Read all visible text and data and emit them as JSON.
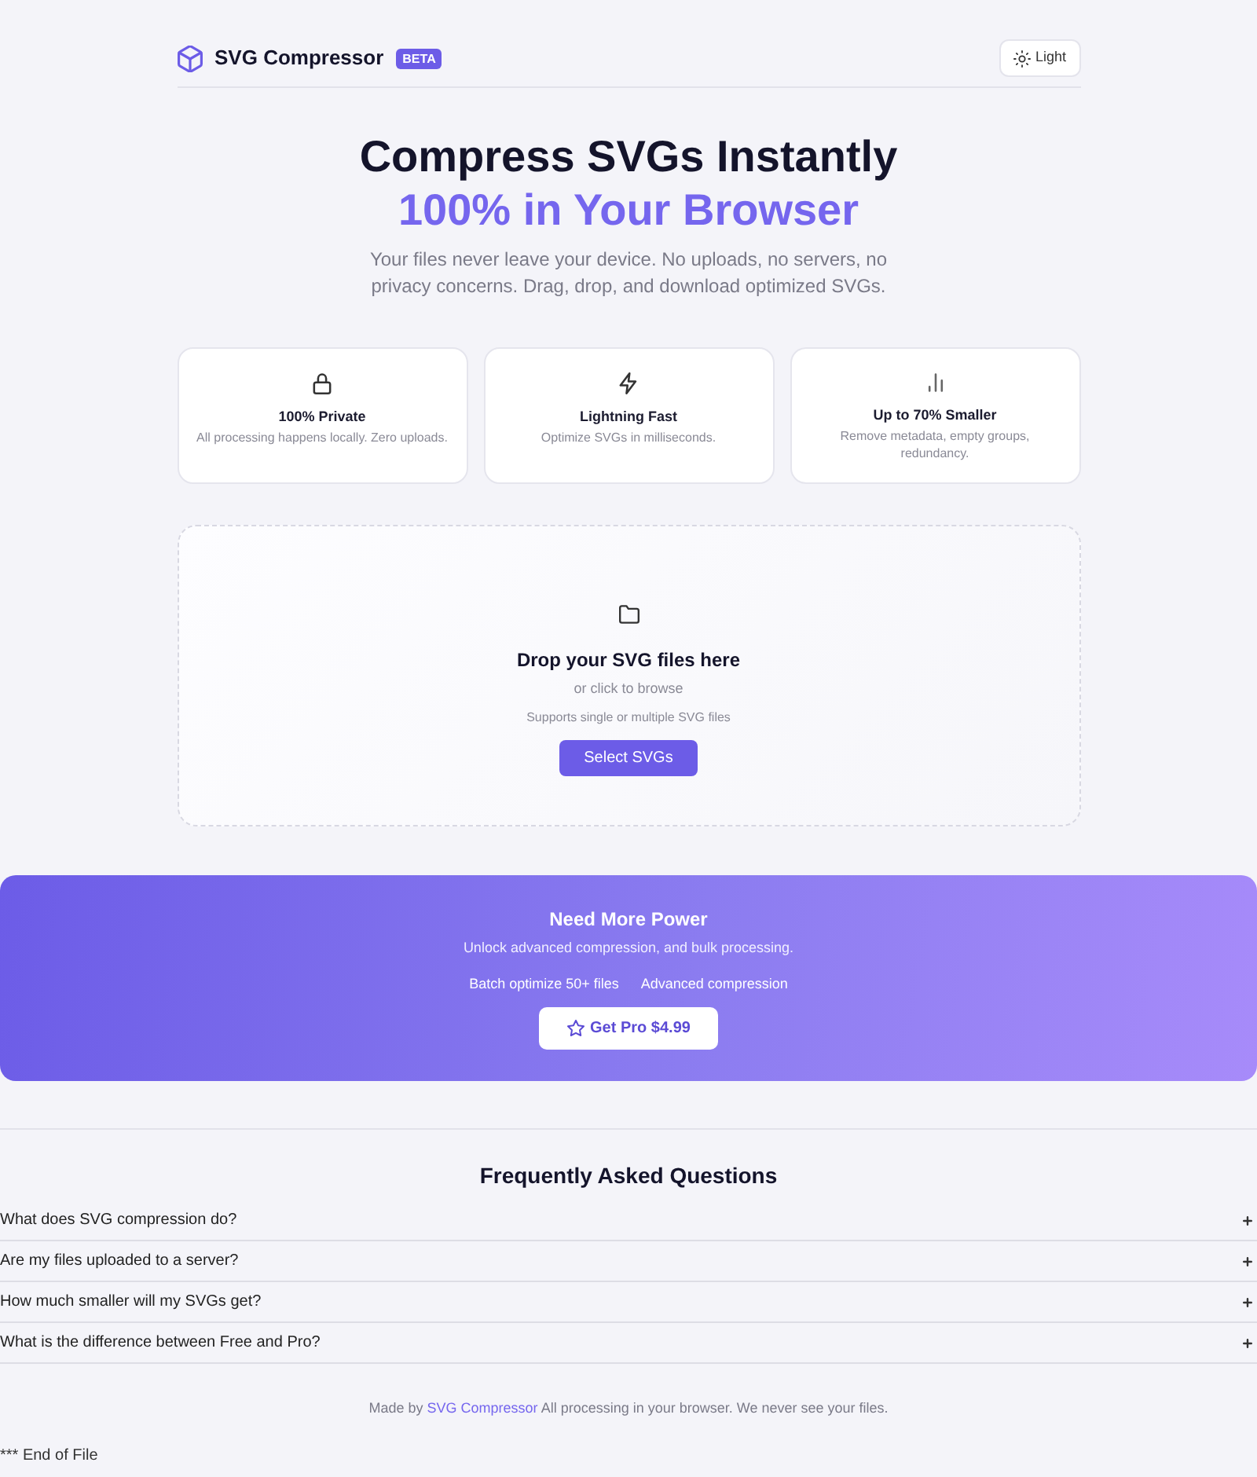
{
  "header": {
    "logo": "SVG Compressor",
    "badge": "BETA",
    "theme_button": "Light"
  },
  "hero": {
    "title": "Compress SVGs Instantly",
    "highlight": "100% in Your Browser",
    "subtitle": "Your files never leave your device. No uploads, no servers, no privacy concerns. Drag, drop, and download optimized SVGs."
  },
  "features": [
    {
      "title": "100% Private",
      "description": "All processing happens locally. Zero uploads."
    },
    {
      "title": "Lightning Fast",
      "description": "Optimize SVGs in milliseconds."
    },
    {
      "title": "Up to 70% Smaller",
      "description": "Remove metadata, empty groups, redundancy."
    }
  ],
  "dropzone": {
    "title": "Drop your SVG files here",
    "hint": "or click to browse",
    "note": "Supports single or multiple SVG files",
    "button": "Select SVGs"
  },
  "pro_banner": {
    "title": "Need More Power",
    "subtitle": "Unlock advanced compression, and bulk processing.",
    "features": [
      "Batch optimize 50+ files",
      "Advanced compression"
    ],
    "button": "Get Pro $4.99"
  },
  "faq": {
    "title": "Frequently Asked Questions",
    "items": [
      {
        "question": "What does SVG compression do?",
        "expanded": false
      },
      {
        "question": "Are my files uploaded to a server?",
        "expanded": false
      },
      {
        "question": "How much smaller will my SVGs get?",
        "expanded": false
      },
      {
        "question": "What is the difference between Free and Pro?",
        "expanded": false
      }
    ]
  },
  "footer": {
    "prefix": "Made by",
    "link": "SVG Compressor",
    "suffix": "All processing in your browser. We never see your files."
  },
  "end_note": "*** End of File"
}
